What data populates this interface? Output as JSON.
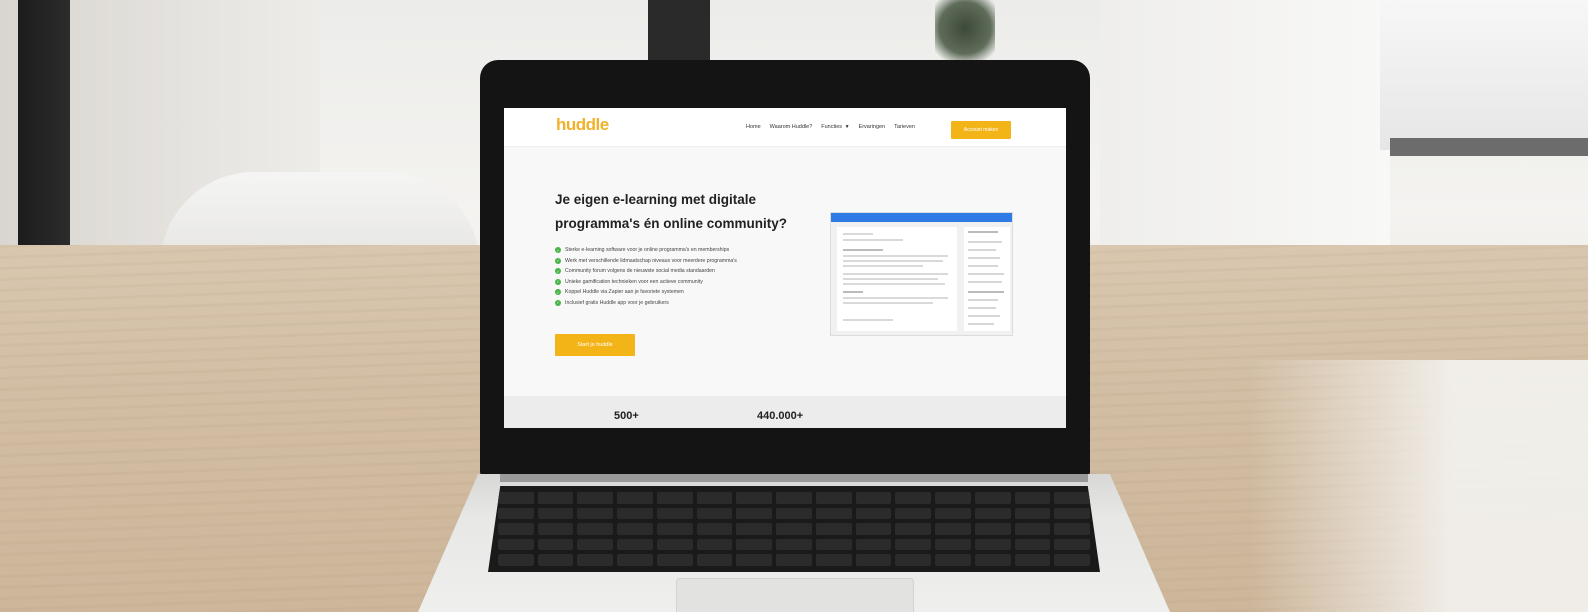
{
  "site": {
    "logo": "huddle",
    "nav": {
      "items": [
        "Home",
        "Waarom Huddle?",
        "Functies",
        "Ervaringen",
        "Tarieven"
      ],
      "cta": "Account maken"
    },
    "hero": {
      "title_line1": "Je eigen e-learning met digitale",
      "title_line2": "programma's én online community?",
      "features": [
        "Sterke e-learning software voor je online programma's en memberships",
        "Werk met verschillende lidmaatschap niveaus voor meerdere programma's",
        "Community forum volgens de nieuwste social media standaarden",
        "Unieke gamification technieken voor een actieve community",
        "Koppel Huddle via Zapier aan je favoriete systemen",
        "Inclusief gratis Huddle app voor je gebruikers"
      ],
      "button": "Start je huddle"
    },
    "stats": [
      "500+",
      "440.000+"
    ]
  },
  "colors": {
    "brand": "#f3b417",
    "check": "#47b34a",
    "preview_bar": "#2f7be5"
  }
}
